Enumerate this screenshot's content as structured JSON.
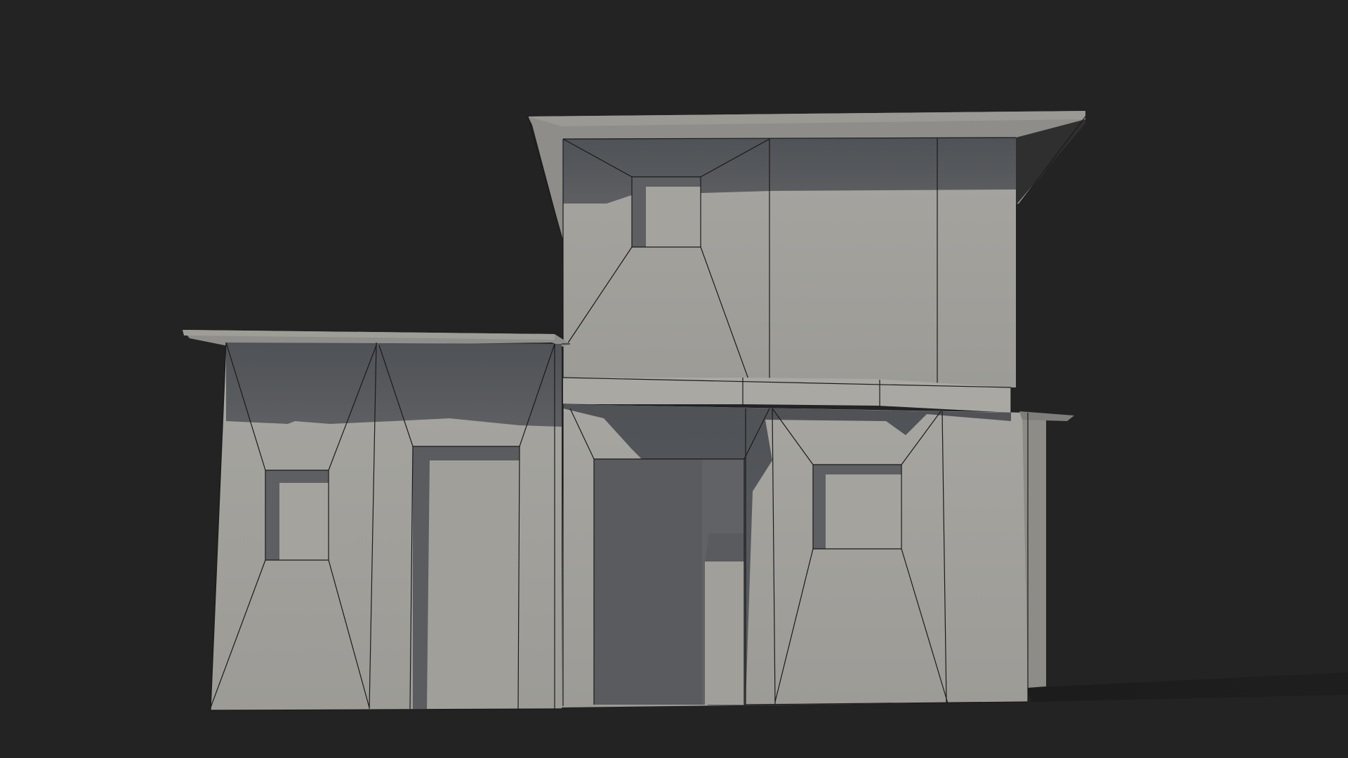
{
  "scene": {
    "subject": "building-model",
    "background_color": "#232323",
    "wall_color": "#a3a29c",
    "wall_light_color": "#a8a7a1",
    "shadow_color": "#595b5e",
    "roof_color": "#8f8e8a",
    "ground_shadow_color": "#1b1b1b"
  }
}
